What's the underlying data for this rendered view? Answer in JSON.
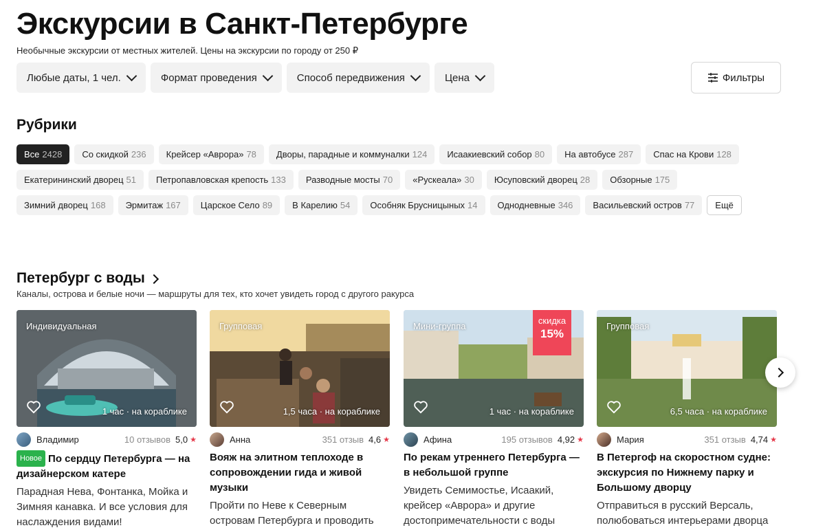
{
  "page": {
    "title": "Экскурсии в Санкт-Петербурге",
    "subtitle": "Необычные экскурсии от местных жителей. Цены на экскурсии по городу от 250 ₽"
  },
  "filters": [
    {
      "label": "Любые даты, 1 чел."
    },
    {
      "label": "Формат проведения"
    },
    {
      "label": "Способ передвижения"
    },
    {
      "label": "Цена"
    }
  ],
  "filters_button": {
    "label": "Фильтры",
    "icon": "sliders-icon"
  },
  "rubrics": {
    "title": "Рубрики",
    "items": [
      {
        "label": "Все",
        "count": "2428",
        "active": true
      },
      {
        "label": "Со скидкой",
        "count": "236"
      },
      {
        "label": "Крейсер «Аврора»",
        "count": "78"
      },
      {
        "label": "Дворы, парадные и коммуналки",
        "count": "124"
      },
      {
        "label": "Исаакиевский собор",
        "count": "80"
      },
      {
        "label": "На автобусе",
        "count": "287"
      },
      {
        "label": "Спас на Крови",
        "count": "128"
      },
      {
        "label": "Екатерининский дворец",
        "count": "51"
      },
      {
        "label": "Петропавловская крепость",
        "count": "133"
      },
      {
        "label": "Разводные мосты",
        "count": "70"
      },
      {
        "label": "«Рускеала»",
        "count": "30"
      },
      {
        "label": "Юсуповский дворец",
        "count": "28"
      },
      {
        "label": "Обзорные",
        "count": "175"
      },
      {
        "label": "Зимний дворец",
        "count": "168"
      },
      {
        "label": "Эрмитаж",
        "count": "167"
      },
      {
        "label": "Царское Село",
        "count": "89"
      },
      {
        "label": "В Карелию",
        "count": "54"
      },
      {
        "label": "Особняк Брусницыных",
        "count": "14"
      },
      {
        "label": "Однодневные",
        "count": "346"
      },
      {
        "label": "Васильевский остров",
        "count": "77"
      }
    ],
    "more_label": "Ещё"
  },
  "section": {
    "title": "Петербург с воды",
    "subtitle": "Каналы, острова и белые ночи — маршруты для тех, кто хочет увидеть город с другого ракурса"
  },
  "cards": [
    {
      "type": "Индивидуальная",
      "duration": "1 час · на кораблике",
      "guide": "Владимир",
      "reviews": "10 отзывов",
      "rating": "5,0",
      "badge": "Новое",
      "title": "По сердцу Петербурга — на дизайнерском катере",
      "desc": "Парадная Нева, Фонтанка, Мойка и Зимняя канавка. И все условия для наслаждения видами!"
    },
    {
      "type": "Групповая",
      "duration": "1,5 часа · на кораблике",
      "guide": "Анна",
      "reviews": "351 отзыв",
      "rating": "4,6",
      "title": "Вояж на элитном теплоходе в сопровождении гида и живой музыки",
      "desc": "Пройти по Неве к Северным островам Петербурга и проводить"
    },
    {
      "type": "Мини-группа",
      "duration": "1 час · на кораблике",
      "guide": "Афина",
      "reviews": "195 отзывов",
      "rating": "4,92",
      "discount_label": "скидка",
      "discount_value": "15%",
      "title": "По рекам утреннего Петербурга — в небольшой группе",
      "desc": "Увидеть Семимостье, Исаакий, крейсер «Аврора» и другие достопримечательности с воды"
    },
    {
      "type": "Групповая",
      "duration": "6,5 часа · на кораблике",
      "guide": "Мария",
      "reviews": "351 отзыв",
      "rating": "4,74",
      "title": "В Петергоф на скоростном судне: экскурсия по Нижнему парку и Большому дворцу",
      "desc": "Отправиться в русский Версаль, полюбоваться интерьерами дворца"
    }
  ],
  "icons": {
    "chevron": "chevron-down-icon",
    "heart": "heart-icon",
    "star": "star-icon",
    "next": "chevron-right-icon"
  },
  "colors": {
    "chip_bg": "#f2f2f2",
    "active_chip": "#222222",
    "discount": "#ef4658",
    "badge_new": "#2bb24c",
    "star": "#e53a4b"
  }
}
